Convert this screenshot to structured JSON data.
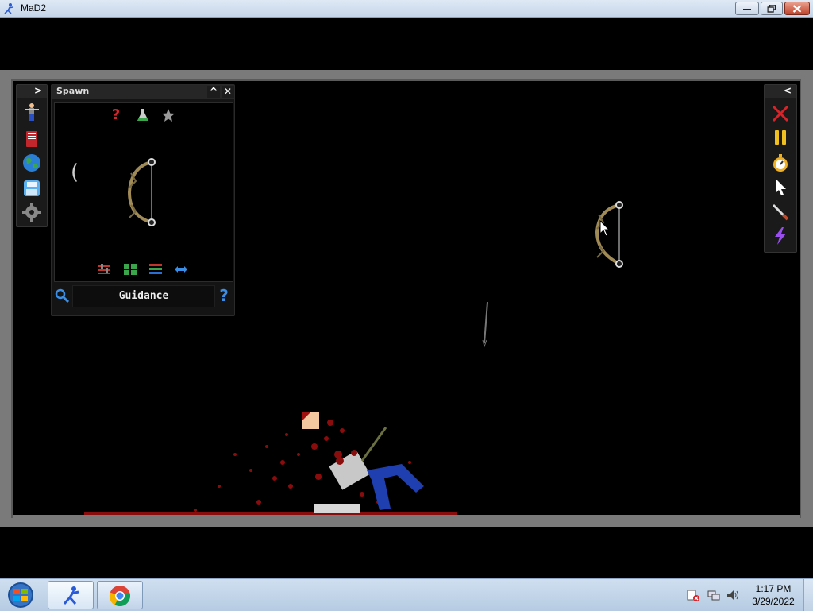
{
  "window": {
    "title": "MaD2"
  },
  "spawn_panel": {
    "title": "Spawn",
    "search_value": "Guidance",
    "category_icons": [
      "question-icon",
      "flask-icon",
      "star-icon"
    ],
    "view_icons": [
      "sliders-icon",
      "grid-icon",
      "list-icon",
      "resize-icon"
    ]
  },
  "left_toolbar": [
    "ragdoll-icon",
    "book-icon",
    "globe-icon",
    "save-icon",
    "settings-icon"
  ],
  "right_toolbar": [
    "close-x-icon",
    "pause-icon",
    "stopwatch-icon",
    "pointer-icon",
    "knife-icon",
    "lightning-icon"
  ],
  "taskbar": {
    "clock_time": "1:17 PM",
    "clock_date": "3/29/2022"
  },
  "colors": {
    "blood": "#8a0d0d",
    "ragdoll_pants": "#1f3fb0",
    "panel_bg": "#141414",
    "frame": "#7a7a7a"
  }
}
